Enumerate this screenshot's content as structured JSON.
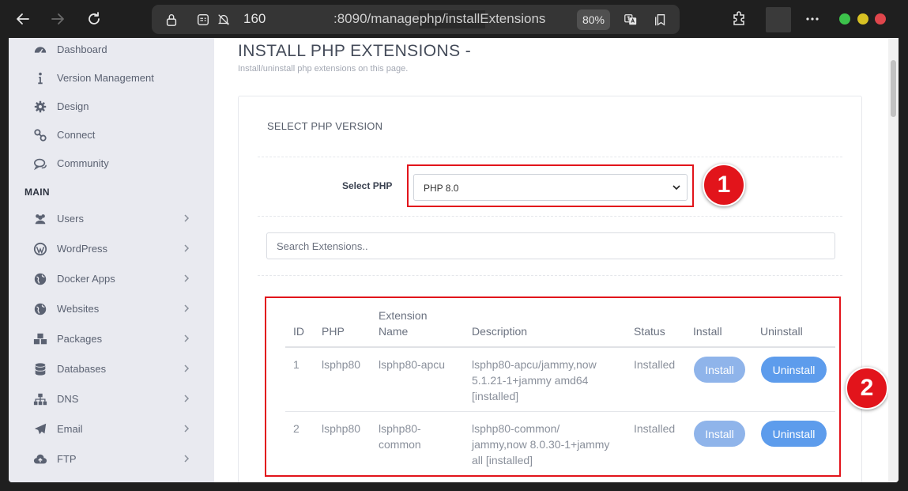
{
  "browser": {
    "url_host": "160",
    "url_path": ":8090/managephp/installExtensions",
    "zoom": "80%"
  },
  "sidebar": {
    "top_items": [
      {
        "label": "Dashboard",
        "icon": "dashboard-icon"
      },
      {
        "label": "Version Management",
        "icon": "info-icon"
      },
      {
        "label": "Design",
        "icon": "gear-icon"
      },
      {
        "label": "Connect",
        "icon": "link-icon"
      },
      {
        "label": "Community",
        "icon": "comments-icon"
      }
    ],
    "section": "MAIN",
    "main_items": [
      {
        "label": "Users",
        "icon": "users-icon"
      },
      {
        "label": "WordPress",
        "icon": "wordpress-icon"
      },
      {
        "label": "Docker Apps",
        "icon": "globe-icon"
      },
      {
        "label": "Websites",
        "icon": "globe-icon"
      },
      {
        "label": "Packages",
        "icon": "cubes-icon"
      },
      {
        "label": "Databases",
        "icon": "database-icon"
      },
      {
        "label": "DNS",
        "icon": "sitemap-icon"
      },
      {
        "label": "Email",
        "icon": "paper-plane-icon"
      },
      {
        "label": "FTP",
        "icon": "cloud-upload-icon"
      }
    ]
  },
  "main": {
    "title": "INSTALL PHP EXTENSIONS -",
    "subtitle": "Install/uninstall php extensions on this page.",
    "card_heading": "SELECT PHP VERSION",
    "select_label": "Select PHP",
    "selected_php": "PHP 8.0",
    "search_placeholder": "Search Extensions..",
    "table": {
      "headers": {
        "id": "ID",
        "php": "PHP",
        "ext_line1": "Extension",
        "ext_line2": "Name",
        "description": "Description",
        "status": "Status",
        "install": "Install",
        "uninstall": "Uninstall"
      },
      "rows": [
        {
          "id": "1",
          "php": "lsphp80",
          "ext_line1": "lsphp80-apcu",
          "ext_line2": "",
          "desc_line1": "lsphp80-apcu/jammy,now",
          "desc_line2": "5.1.21-1+jammy amd64",
          "desc_line3": "[installed]",
          "status": "Installed",
          "install_label": "Install",
          "uninstall_label": "Uninstall"
        },
        {
          "id": "2",
          "php": "lsphp80",
          "ext_line1": "lsphp80-",
          "ext_line2": "common",
          "desc_line1": "lsphp80-common/",
          "desc_line2": "jammy,now 8.0.30-1+jammy",
          "desc_line3": "all [installed]",
          "status": "Installed",
          "install_label": "Install",
          "uninstall_label": "Uninstall"
        }
      ]
    }
  },
  "annotations": {
    "badge_1": "1",
    "badge_2": "2"
  },
  "colors": {
    "accent_red": "#e2141b",
    "button_blue": "#5d9cec",
    "button_blue_light": "#8fb4ea"
  }
}
